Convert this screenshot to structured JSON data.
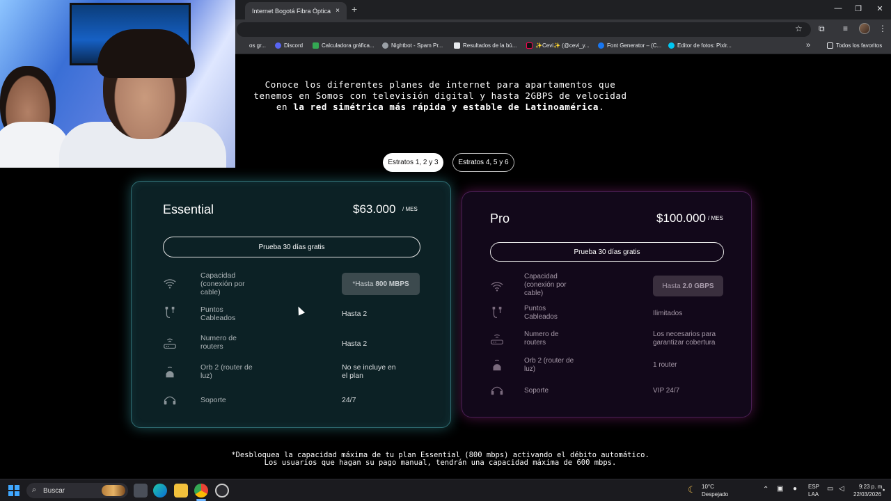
{
  "browser": {
    "tab_title": "Internet Bogotá Fibra Óptica | S",
    "tab_close": "×",
    "new_tab": "+",
    "window_controls": [
      "—",
      "❐",
      "✕"
    ],
    "bookmarks": [
      {
        "label": "os gr...",
        "icon_color": "#8ab4f8"
      },
      {
        "label": "Discord",
        "icon_color": "#5865f2"
      },
      {
        "label": "Calculadora gráfica...",
        "icon_color": "#34a853"
      },
      {
        "label": "Nightbot - Spam Pr...",
        "icon_color": "#9aa0a6"
      },
      {
        "label": "Resultados de la bú...",
        "icon_color": "#e8eaed"
      },
      {
        "label": "✨Cevi✨ (@cevi_y...",
        "icon_color": "#ff0050"
      },
      {
        "label": "Font Generator – (C...",
        "icon_color": "#1877f2"
      },
      {
        "label": "Editor de fotos: Pixlr...",
        "icon_color": "#00c7f2"
      }
    ],
    "bookmarks_overflow": "»",
    "all_bookmarks": "Todos los favoritos"
  },
  "page": {
    "intro_plain": "Conoce los diferentes planes de internet para apartamentos que tenemos en Somos con televisión digital y hasta 2GBPS de velocidad en ",
    "intro_bold": "la red simétrica más rápida y estable de Latinoamérica",
    "intro_end": ".",
    "toggle": {
      "active": "Estratos 1, 2 y 3",
      "inactive": "Estratos 4, 5 y 6"
    },
    "plans": [
      {
        "name": "Essential",
        "price": "$63.000",
        "period": "/ MES",
        "trial": "Prueba 30 días gratis",
        "features": [
          {
            "icon": "wifi-icon",
            "label": "Capacidad (conexión por cable)",
            "value_prefix": "*Hasta",
            "value_bold": "800 MBPS"
          },
          {
            "icon": "cable-icon",
            "label": "Puntos Cableados",
            "value": "Hasta 2"
          },
          {
            "icon": "router-icon",
            "label": "Numero de routers",
            "value": "Hasta 2"
          },
          {
            "icon": "orb-icon",
            "label": "Orb 2 (router de luz)",
            "value": "No se incluye en el plan"
          },
          {
            "icon": "headset-icon",
            "label": "Soporte",
            "value": "24/7"
          }
        ]
      },
      {
        "name": "Pro",
        "price": "$100.000",
        "period": "/ MES",
        "trial": "Prueba 30 días gratis",
        "features": [
          {
            "icon": "wifi-icon",
            "label": "Capacidad (conexión por cable)",
            "value_prefix": "Hasta",
            "value_bold": "2.0 GBPS"
          },
          {
            "icon": "cable-icon",
            "label": "Puntos Cableados",
            "value": "Ilimitados"
          },
          {
            "icon": "router-icon",
            "label": "Numero de routers",
            "value": "Los necesarios para garantizar cobertura"
          },
          {
            "icon": "orb-icon",
            "label": "Orb 2 (router de luz)",
            "value": "1 router"
          },
          {
            "icon": "headset-icon",
            "label": "Soporte",
            "value": "VIP 24/7"
          }
        ]
      }
    ],
    "footnote_line1": "*Desbloquea la capacidad máxima de tu plan Essential (800 mbps) activando el débito automático.",
    "footnote_line2": "Los usuarios que hagan su pago manual, tendrán una capacidad máxima de 600 mbps."
  },
  "taskbar": {
    "search_label": "Buscar",
    "weather_temp": "10°C",
    "weather_desc": "Despejado",
    "lang_top": "ESP",
    "lang_bottom": "LAA",
    "time": "9:23 p. m.",
    "date": "22/03/2026"
  },
  "colors": {
    "essential_glow": "#2f6d73",
    "pro_glow": "#4a1f55",
    "accent": "#6cb4ff"
  }
}
